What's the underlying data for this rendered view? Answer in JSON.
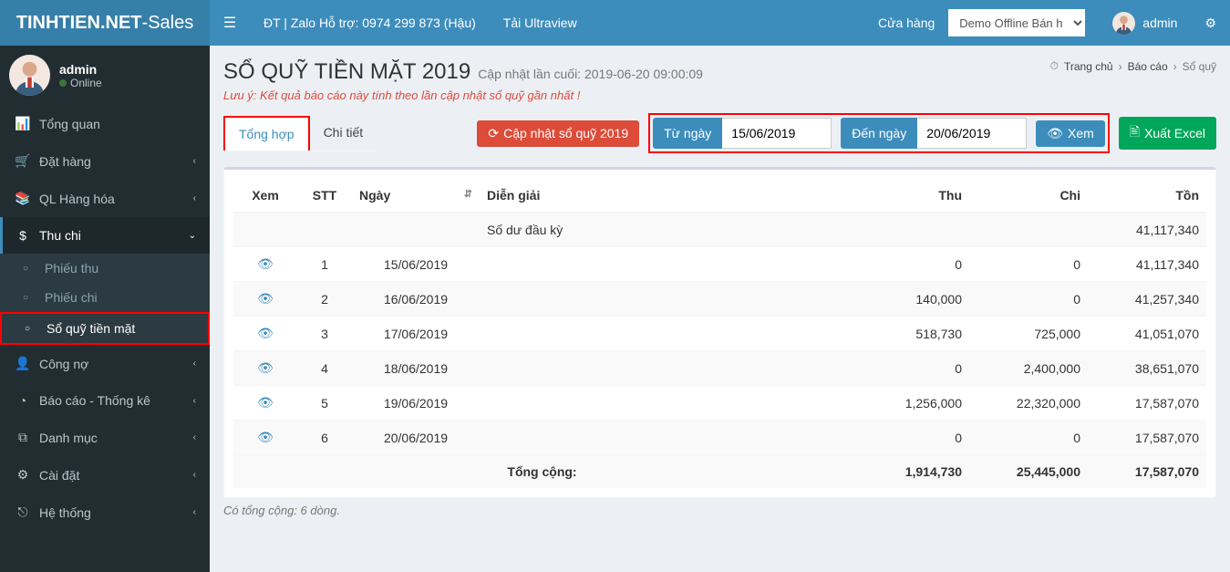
{
  "topbar": {
    "brand_bold": "TINHTIEN.NET",
    "brand_rest": "-Sales",
    "support": "ĐT | Zalo Hỗ trợ: 0974 299 873 (Hậu)",
    "download": "Tải Ultraview",
    "store_label": "Cửa hàng",
    "store_selected": "Demo Offline Bán hàr",
    "username": "admin"
  },
  "user_panel": {
    "name": "admin",
    "status": "Online"
  },
  "sidebar": [
    {
      "label": "Tổng quan",
      "icon": "dashboard",
      "arrow": ""
    },
    {
      "label": "Đặt hàng",
      "icon": "cart",
      "arrow": "‹"
    },
    {
      "label": "QL Hàng hóa",
      "icon": "package",
      "arrow": "‹"
    },
    {
      "label": "Thu chi",
      "icon": "money",
      "arrow": "⌄",
      "active": true,
      "sub": [
        {
          "label": "Phiếu thu",
          "active": false
        },
        {
          "label": "Phiếu chi",
          "active": false
        },
        {
          "label": "Sổ quỹ tiền mặt",
          "active": true,
          "highlight": true
        }
      ]
    },
    {
      "label": "Công nợ",
      "icon": "user",
      "arrow": "‹"
    },
    {
      "label": "Báo cáo - Thống kê",
      "icon": "pie",
      "arrow": "‹"
    },
    {
      "label": "Danh mục",
      "icon": "copy",
      "arrow": "‹"
    },
    {
      "label": "Cài đặt",
      "icon": "gear",
      "arrow": "‹"
    },
    {
      "label": "Hệ thống",
      "icon": "exit",
      "arrow": "‹"
    }
  ],
  "breadcrumb": {
    "home": "Trang chủ",
    "mid": "Báo cáo",
    "last": "Sổ quỹ"
  },
  "page": {
    "title": "SỔ QUỸ TIỀN MẶT 2019",
    "subtitle": "Cập nhật lần cuối: 2019-06-20 09:00:09",
    "note": "Lưu ý: Kết quả báo cáo này tính theo lần cập nhật sổ quỹ gần nhất !"
  },
  "tabs": {
    "summary": "Tổng hợp",
    "detail": "Chi tiết"
  },
  "buttons": {
    "refresh": "Cập nhật sổ quỹ 2019",
    "from": "Từ ngày",
    "to": "Đến ngày",
    "view": "Xem",
    "excel": "Xuất Excel"
  },
  "filter": {
    "from_value": "15/06/2019",
    "to_value": "20/06/2019"
  },
  "columns": {
    "view": "Xem",
    "stt": "STT",
    "date": "Ngày",
    "desc": "Diễn giải",
    "thu": "Thu",
    "chi": "Chi",
    "ton": "Tồn"
  },
  "opening_row": {
    "desc": "Số dư đầu kỳ",
    "ton": "41,117,340"
  },
  "rows": [
    {
      "stt": "1",
      "date": "15/06/2019",
      "thu": "0",
      "chi": "0",
      "ton": "41,117,340"
    },
    {
      "stt": "2",
      "date": "16/06/2019",
      "thu": "140,000",
      "chi": "0",
      "ton": "41,257,340"
    },
    {
      "stt": "3",
      "date": "17/06/2019",
      "thu": "518,730",
      "chi": "725,000",
      "ton": "41,051,070"
    },
    {
      "stt": "4",
      "date": "18/06/2019",
      "thu": "0",
      "chi": "2,400,000",
      "ton": "38,651,070"
    },
    {
      "stt": "5",
      "date": "19/06/2019",
      "thu": "1,256,000",
      "chi": "22,320,000",
      "ton": "17,587,070"
    },
    {
      "stt": "6",
      "date": "20/06/2019",
      "thu": "0",
      "chi": "0",
      "ton": "17,587,070"
    }
  ],
  "totals": {
    "label": "Tổng cộng:",
    "thu": "1,914,730",
    "chi": "25,445,000",
    "ton": "17,587,070"
  },
  "footer_note": "Có tổng cộng: 6 dòng."
}
